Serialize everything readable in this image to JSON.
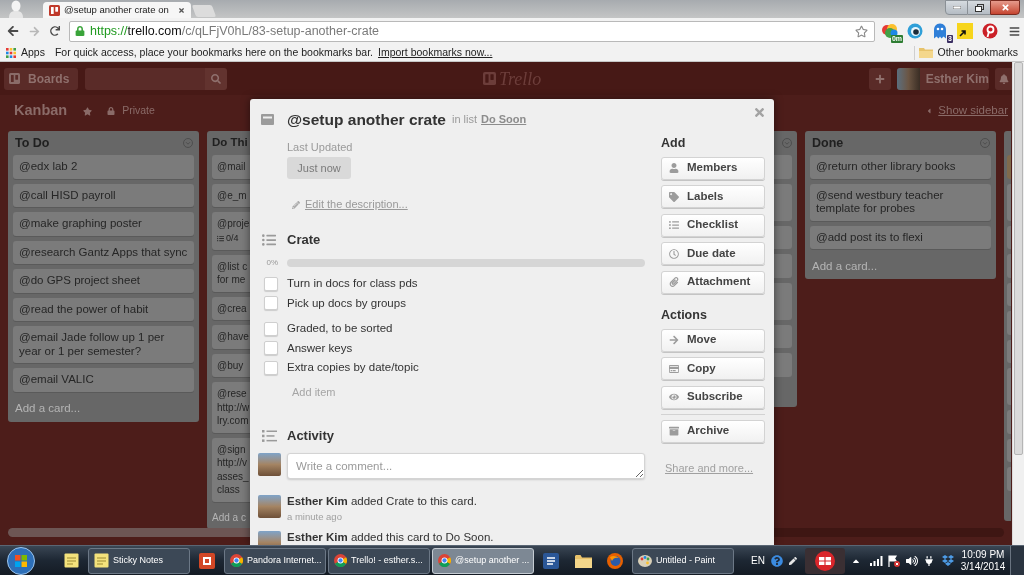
{
  "browser": {
    "tab": {
      "title": "@setup another crate on",
      "selected": true
    },
    "address": {
      "scheme": "https://",
      "host": "trello.com",
      "path": "/c/qLFjV0hL/83-setup-another-crate"
    },
    "extensions": [
      {
        "kind": "blob",
        "badge": "0m"
      },
      {
        "kind": "eye"
      },
      {
        "kind": "ghost",
        "badge": "3"
      },
      {
        "kind": "note"
      },
      {
        "kind": "pin"
      }
    ],
    "bookmarks": {
      "apps": "Apps",
      "hint": "For quick access, place your bookmarks here on the bookmarks bar.",
      "import_link": "Import bookmarks now...",
      "other": "Other bookmarks"
    }
  },
  "header": {
    "boards": "Boards",
    "logo": "Trello",
    "user": "Esther Kim"
  },
  "board": {
    "title": "Kanban",
    "visibility": "Private",
    "show_sidebar": "Show sidebar",
    "lists": [
      {
        "kind": "full",
        "title": "To Do",
        "cards": [
          {
            "lines": [
              "@edx lab 2"
            ]
          },
          {
            "lines": [
              "@call HISD payroll"
            ]
          },
          {
            "lines": [
              "@make graphing poster"
            ]
          },
          {
            "lines": [
              "@research Gantz Apps that sync"
            ]
          },
          {
            "lines": [
              "@do GPS project sheet"
            ]
          },
          {
            "lines": [
              "@read the power of habit"
            ]
          },
          {
            "lines": [
              "@email Jade follow up 1 per",
              "year or 1 per semester?"
            ]
          },
          {
            "lines": [
              "@email VALIC"
            ]
          }
        ],
        "add_card": "Add a card..."
      },
      {
        "kind": "clipped",
        "title": "Do Thi",
        "cards": [
          {
            "lines": [
              "@mail"
            ]
          },
          {
            "lines": [
              "@e_m"
            ]
          },
          {
            "lines": [
              "@proje"
            ],
            "badge": "0/4"
          },
          {
            "lines": [
              "@list c",
              "for me"
            ]
          },
          {
            "lines": [
              "@crea"
            ]
          },
          {
            "lines": [
              "@have"
            ]
          },
          {
            "lines": [
              "@buy"
            ]
          },
          {
            "lines": [
              "@rese",
              "http://w",
              "lry.com"
            ]
          },
          {
            "lines": [
              "@sign",
              "http://v",
              "asses_",
              "class"
            ]
          }
        ],
        "add_card": "Add a c"
      },
      {
        "kind": "edge",
        "cards": [
          {
            "kind": "short"
          },
          {
            "kind": "tall"
          },
          {
            "kind": "short"
          },
          {
            "kind": "short"
          },
          {
            "kind": "tall"
          },
          {
            "kind": "short"
          },
          {
            "kind": "short"
          }
        ]
      },
      {
        "kind": "full",
        "title": "Done",
        "cards": [
          {
            "lines": [
              "@return other library books"
            ]
          },
          {
            "lines": [
              "@send westbury teacher",
              "template for probes"
            ]
          },
          {
            "lines": [
              "@add post its to flexi"
            ]
          }
        ],
        "add_card": "Add a card..."
      },
      {
        "kind": "sliver",
        "cards": [
          {
            "kind": "cover"
          },
          {
            "kind": "tall"
          },
          {
            "kind": "short"
          },
          {
            "kind": "short"
          },
          {
            "kind": "short"
          },
          {
            "kind": "short"
          },
          {
            "kind": "short"
          },
          {
            "kind": "tall"
          },
          {
            "kind": "short"
          },
          {
            "kind": "short"
          },
          {
            "kind": "short"
          }
        ]
      }
    ]
  },
  "card_modal": {
    "title": "@setup another crate",
    "in_list": "in list",
    "list_name": "Do Soon",
    "last_updated": {
      "label": "Last Updated",
      "value": "Just now"
    },
    "edit_description": "Edit the description...",
    "checklist": {
      "title": "Crate",
      "percent": "0%",
      "level": 0,
      "groups": [
        {
          "items": [
            {
              "text": "Turn in docs for class pds",
              "checked": false
            },
            {
              "text": "Pick up docs by groups",
              "checked": false
            }
          ]
        },
        {
          "items": [
            {
              "text": "Graded, to be sorted",
              "checked": false
            },
            {
              "text": "Answer keys",
              "checked": false
            },
            {
              "text": "Extra copies by date/topic",
              "checked": false
            }
          ]
        }
      ],
      "add_item": "Add item"
    },
    "activity": {
      "title": "Activity",
      "comment": {
        "placeholder": "Write a comment..."
      },
      "entries": [
        {
          "text": "**Esther Kim** added Crate to this card.",
          "time": "a minute ago"
        },
        {
          "text": "**Esther Kim** added this card to Do Soon."
        }
      ]
    },
    "sidebar": [
      {
        "title": "Add",
        "buttons": [
          {
            "label": "Members"
          },
          {
            "label": "Labels"
          },
          {
            "label": "Checklist"
          },
          {
            "label": "Due date"
          },
          {
            "label": "Attachment"
          }
        ]
      },
      {
        "title": "Actions",
        "buttons": [
          {
            "label": "Move"
          },
          {
            "label": "Copy"
          },
          {
            "label": "Subscribe"
          }
        ]
      },
      {
        "buttons": [
          {
            "label": "Archive"
          }
        ]
      }
    ],
    "share_link": "Share and more..."
  },
  "taskbar": {
    "items": [
      {
        "kind": "pinned"
      },
      {
        "kind": "window",
        "label": "Sticky Notes",
        "selected": false
      },
      {
        "kind": "pinned"
      },
      {
        "kind": "window",
        "label": "Pandora Internet...",
        "selected": false
      },
      {
        "kind": "window",
        "label": "Trello! - esther.s...",
        "selected": false
      },
      {
        "kind": "window",
        "label": "@setup another ...",
        "selected": true
      },
      {
        "kind": "pinned"
      },
      {
        "kind": "pinned"
      },
      {
        "kind": "pinned"
      },
      {
        "kind": "window",
        "label": "Untitled - Paint",
        "selected": false
      }
    ],
    "language": "EN",
    "time": "10:09 PM",
    "date": "3/14/2014"
  }
}
